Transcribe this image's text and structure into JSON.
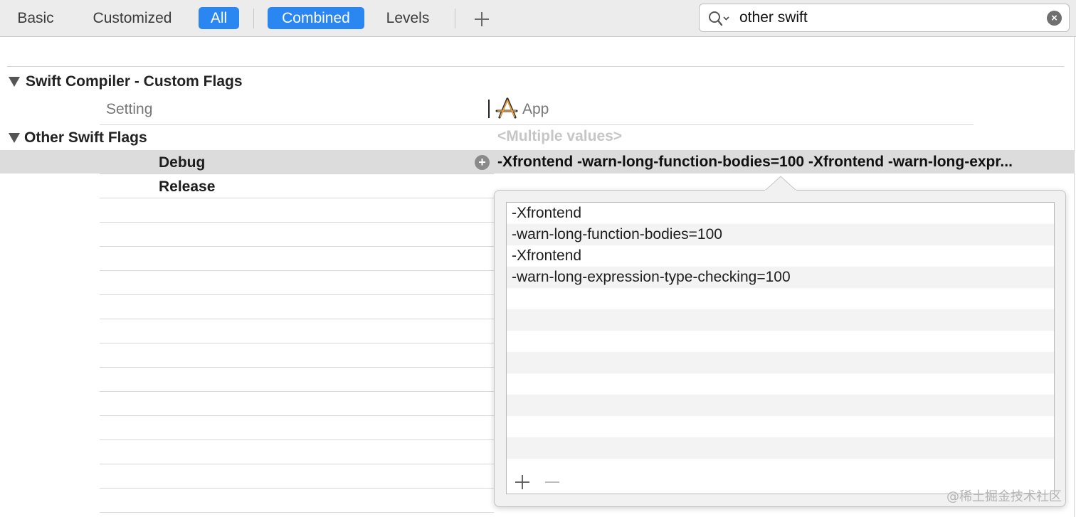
{
  "toolbar": {
    "tabs": [
      {
        "label": "Basic",
        "selected": false
      },
      {
        "label": "Customized",
        "selected": false
      },
      {
        "label": "All",
        "selected": true
      },
      {
        "label": "Combined",
        "selected": true
      },
      {
        "label": "Levels",
        "selected": false
      }
    ],
    "add_icon": "plus-icon"
  },
  "search": {
    "value": "other swift",
    "icon": "search-icon",
    "clear_icon": "clear-icon"
  },
  "section": {
    "title": "Swift Compiler - Custom Flags",
    "column_setting": "Setting",
    "column_target": "App",
    "target_icon": "app-target-icon"
  },
  "setting": {
    "name": "Other Swift Flags",
    "value": "<Multiple values>",
    "rows": [
      {
        "label": "Debug",
        "value": "-Xfrontend -warn-long-function-bodies=100 -Xfrontend -warn-long-expr..."
      },
      {
        "label": "Release",
        "value": ""
      }
    ]
  },
  "popover": {
    "items": [
      "-Xfrontend",
      "-warn-long-function-bodies=100",
      "-Xfrontend",
      "-warn-long-expression-type-checking=100"
    ],
    "add_icon": "plus-icon",
    "remove_icon": "minus-icon"
  },
  "watermark": "@稀土掘金技术社区",
  "colors": {
    "accent": "#2a86f0",
    "toolbar_bg": "#ececec",
    "selected_row": "#dcdcdc"
  }
}
